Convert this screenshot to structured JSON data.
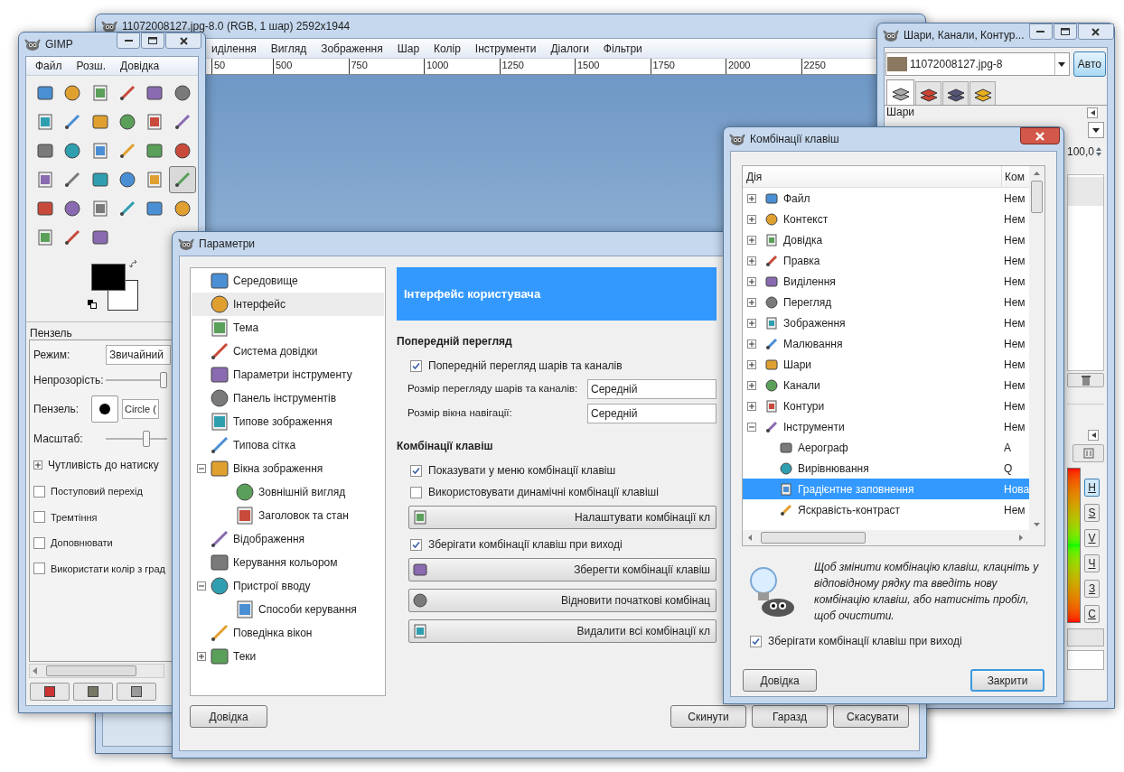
{
  "image_window": {
    "title": "11072008127.jpg-8.0 (RGB, 1 шар) 2592x1944",
    "menu": [
      "иділення",
      "Вигляд",
      "Зображення",
      "Шар",
      "Колір",
      "Інструменти",
      "Діалоги",
      "Фільтри"
    ],
    "ruler": [
      "50",
      "500",
      "750",
      "1000",
      "1250",
      "1500",
      "1750",
      "2000",
      "2250"
    ]
  },
  "toolbox": {
    "title": "GIMP",
    "menu": [
      "Файл",
      "Розш.",
      "Довідка"
    ],
    "tools": [
      {
        "selected": false
      },
      {
        "selected": false
      },
      {
        "selected": false
      },
      {
        "selected": false
      },
      {
        "selected": false
      },
      {
        "selected": false
      },
      {
        "selected": false
      },
      {
        "selected": false
      },
      {
        "selected": false
      },
      {
        "selected": false
      },
      {
        "selected": false
      },
      {
        "selected": false
      },
      {
        "selected": false
      },
      {
        "selected": false
      },
      {
        "selected": false
      },
      {
        "selected": false
      },
      {
        "selected": false
      },
      {
        "selected": false
      },
      {
        "selected": false
      },
      {
        "selected": false
      },
      {
        "selected": false
      },
      {
        "selected": false
      },
      {
        "selected": false
      },
      {
        "selected": true
      },
      {
        "selected": false
      },
      {
        "selected": false
      },
      {
        "selected": false
      },
      {
        "selected": false
      },
      {
        "selected": false
      },
      {
        "selected": false
      },
      {
        "selected": false
      },
      {
        "selected": false
      },
      {
        "selected": false
      }
    ],
    "options": {
      "title": "Пензель",
      "mode_label": "Режим:",
      "mode_value": "Звичайний",
      "opacity_label": "Непрозорість:",
      "opacity": {
        "level": 1
      },
      "brush_label": "Пензель:",
      "brush_value": "Circle (",
      "scale_label": "Масштаб:",
      "scale": {
        "level": 0.68
      },
      "expander": {
        "label": "Чутливість до натиску",
        "expanded": false
      },
      "checks": [
        {
          "label": "Поступовий перехід",
          "checked": false
        },
        {
          "label": "Тремтіння",
          "checked": false
        },
        {
          "label": "Доповнювати",
          "checked": false
        },
        {
          "label": "Використати колір з град",
          "checked": false
        }
      ]
    }
  },
  "layers_dock": {
    "title": "Шари, Канали, Контур...",
    "image": "11072008127.jpg-8",
    "auto": "Авто",
    "tabs": [
      {
        "selected": true
      },
      {
        "selected": false
      },
      {
        "selected": false
      },
      {
        "selected": false
      }
    ],
    "panel_title": "Шари",
    "opacity_value": "100,0",
    "channels": [
      {
        "label": "H",
        "selected": true
      },
      {
        "label": "S",
        "selected": false
      },
      {
        "label": "V",
        "selected": false
      },
      {
        "label": "Ч",
        "selected": false
      },
      {
        "label": "З",
        "selected": false
      },
      {
        "label": "С",
        "selected": false
      }
    ]
  },
  "preferences": {
    "title": "Параметри",
    "tree": [
      {
        "label": "Середовище",
        "selected": false
      },
      {
        "label": "Інтерфейс",
        "selected": true
      },
      {
        "label": "Тема",
        "selected": false
      },
      {
        "label": "Система довідки",
        "selected": false
      },
      {
        "label": "Параметри інструменту",
        "selected": false
      },
      {
        "label": "Панель інструментів",
        "selected": false
      },
      {
        "label": "Типове зображення",
        "selected": false
      },
      {
        "label": "Типова сітка",
        "selected": false
      },
      {
        "label": "Вікна зображення",
        "selected": false,
        "expanded": true,
        "children": [
          {
            "label": "Зовнішній вигляд",
            "selected": false
          },
          {
            "label": "Заголовок та стан",
            "selected": false
          }
        ]
      },
      {
        "label": "Відображення",
        "selected": false
      },
      {
        "label": "Керування кольором",
        "selected": false
      },
      {
        "label": "Пристрої вводу",
        "selected": false,
        "expanded": true,
        "children": [
          {
            "label": "Способи керування",
            "selected": false
          }
        ]
      },
      {
        "label": "Поведінка вікон",
        "selected": false
      },
      {
        "label": "Теки",
        "selected": false,
        "expanded": false
      }
    ],
    "header": "Інтерфейс користувача",
    "sections": [
      {
        "title": "Попередній перегляд",
        "items": [
          {
            "kind": "check",
            "label": "Попередній перегляд шарів та каналів",
            "checked": true
          },
          {
            "kind": "combo",
            "label": "Розмір перегляду шарів та каналів:",
            "value": "Середній"
          },
          {
            "kind": "combo",
            "label": "Розмір вікна навігації:",
            "value": "Середній"
          }
        ]
      },
      {
        "title": "Комбінації клавіш",
        "items": [
          {
            "kind": "check",
            "label": "Показувати у меню комбінації клавіш",
            "checked": true
          },
          {
            "kind": "check",
            "label": "Використовувати динамічні комбінації клавіші",
            "checked": false
          },
          {
            "kind": "button",
            "label": "Налаштувати комбінації кл"
          },
          {
            "kind": "check",
            "label": "Зберігати комбінації клавіш при виході",
            "checked": true
          },
          {
            "kind": "button",
            "label": "Зберегти комбінації клавіш"
          },
          {
            "kind": "button",
            "label": "Відновити початкові комбінац"
          },
          {
            "kind": "button",
            "label": "Видалити всі комбінації кл"
          }
        ]
      }
    ],
    "buttons": {
      "help": "Довідка",
      "reset": "Скинути",
      "ok": "Гаразд",
      "cancel": "Скасувати"
    }
  },
  "shortcuts_dialog": {
    "title": "Комбінації клавіш",
    "columns": [
      "Дія",
      "Ком"
    ],
    "rows": [
      {
        "label": "Файл",
        "shortcut": "Нем",
        "expanded": false,
        "selected": false
      },
      {
        "label": "Контекст",
        "shortcut": "Нем",
        "expanded": false,
        "selected": false
      },
      {
        "label": "Довідка",
        "shortcut": "Нем",
        "expanded": false,
        "selected": false
      },
      {
        "label": "Правка",
        "shortcut": "Нем",
        "expanded": false,
        "selected": false
      },
      {
        "label": "Виділення",
        "shortcut": "Нем",
        "expanded": false,
        "selected": false
      },
      {
        "label": "Перегляд",
        "shortcut": "Нем",
        "expanded": false,
        "selected": false
      },
      {
        "label": "Зображення",
        "shortcut": "Нем",
        "expanded": false,
        "selected": false
      },
      {
        "label": "Малювання",
        "shortcut": "Нем",
        "expanded": false,
        "selected": false
      },
      {
        "label": "Шари",
        "shortcut": "Нем",
        "expanded": false,
        "selected": false
      },
      {
        "label": "Канали",
        "shortcut": "Нем",
        "expanded": false,
        "selected": false
      },
      {
        "label": "Контури",
        "shortcut": "Нем",
        "expanded": false,
        "selected": false
      },
      {
        "label": "Інструменти",
        "shortcut": "Нем",
        "expanded": true,
        "selected": false,
        "children": [
          {
            "label": "Аерограф",
            "shortcut": "A",
            "selected": false
          },
          {
            "label": "Вирівнювання",
            "shortcut": "Q",
            "selected": false
          },
          {
            "label": "Градієнтне заповнення",
            "shortcut": "Нова",
            "selected": true
          },
          {
            "label": "Яскравість-контраст",
            "shortcut": "Нем",
            "selected": false
          }
        ]
      }
    ],
    "hint": "Щоб змінити комбінацію клавіш, клацніть у відповідному рядку та введіть нову комбінацію клавіш, або натисніть пробіл, щоб очистити.",
    "save_check": {
      "label": "Зберігати комбінації клавіш при виході",
      "checked": true
    },
    "buttons": [
      "Довідка",
      "Закрити"
    ]
  }
}
